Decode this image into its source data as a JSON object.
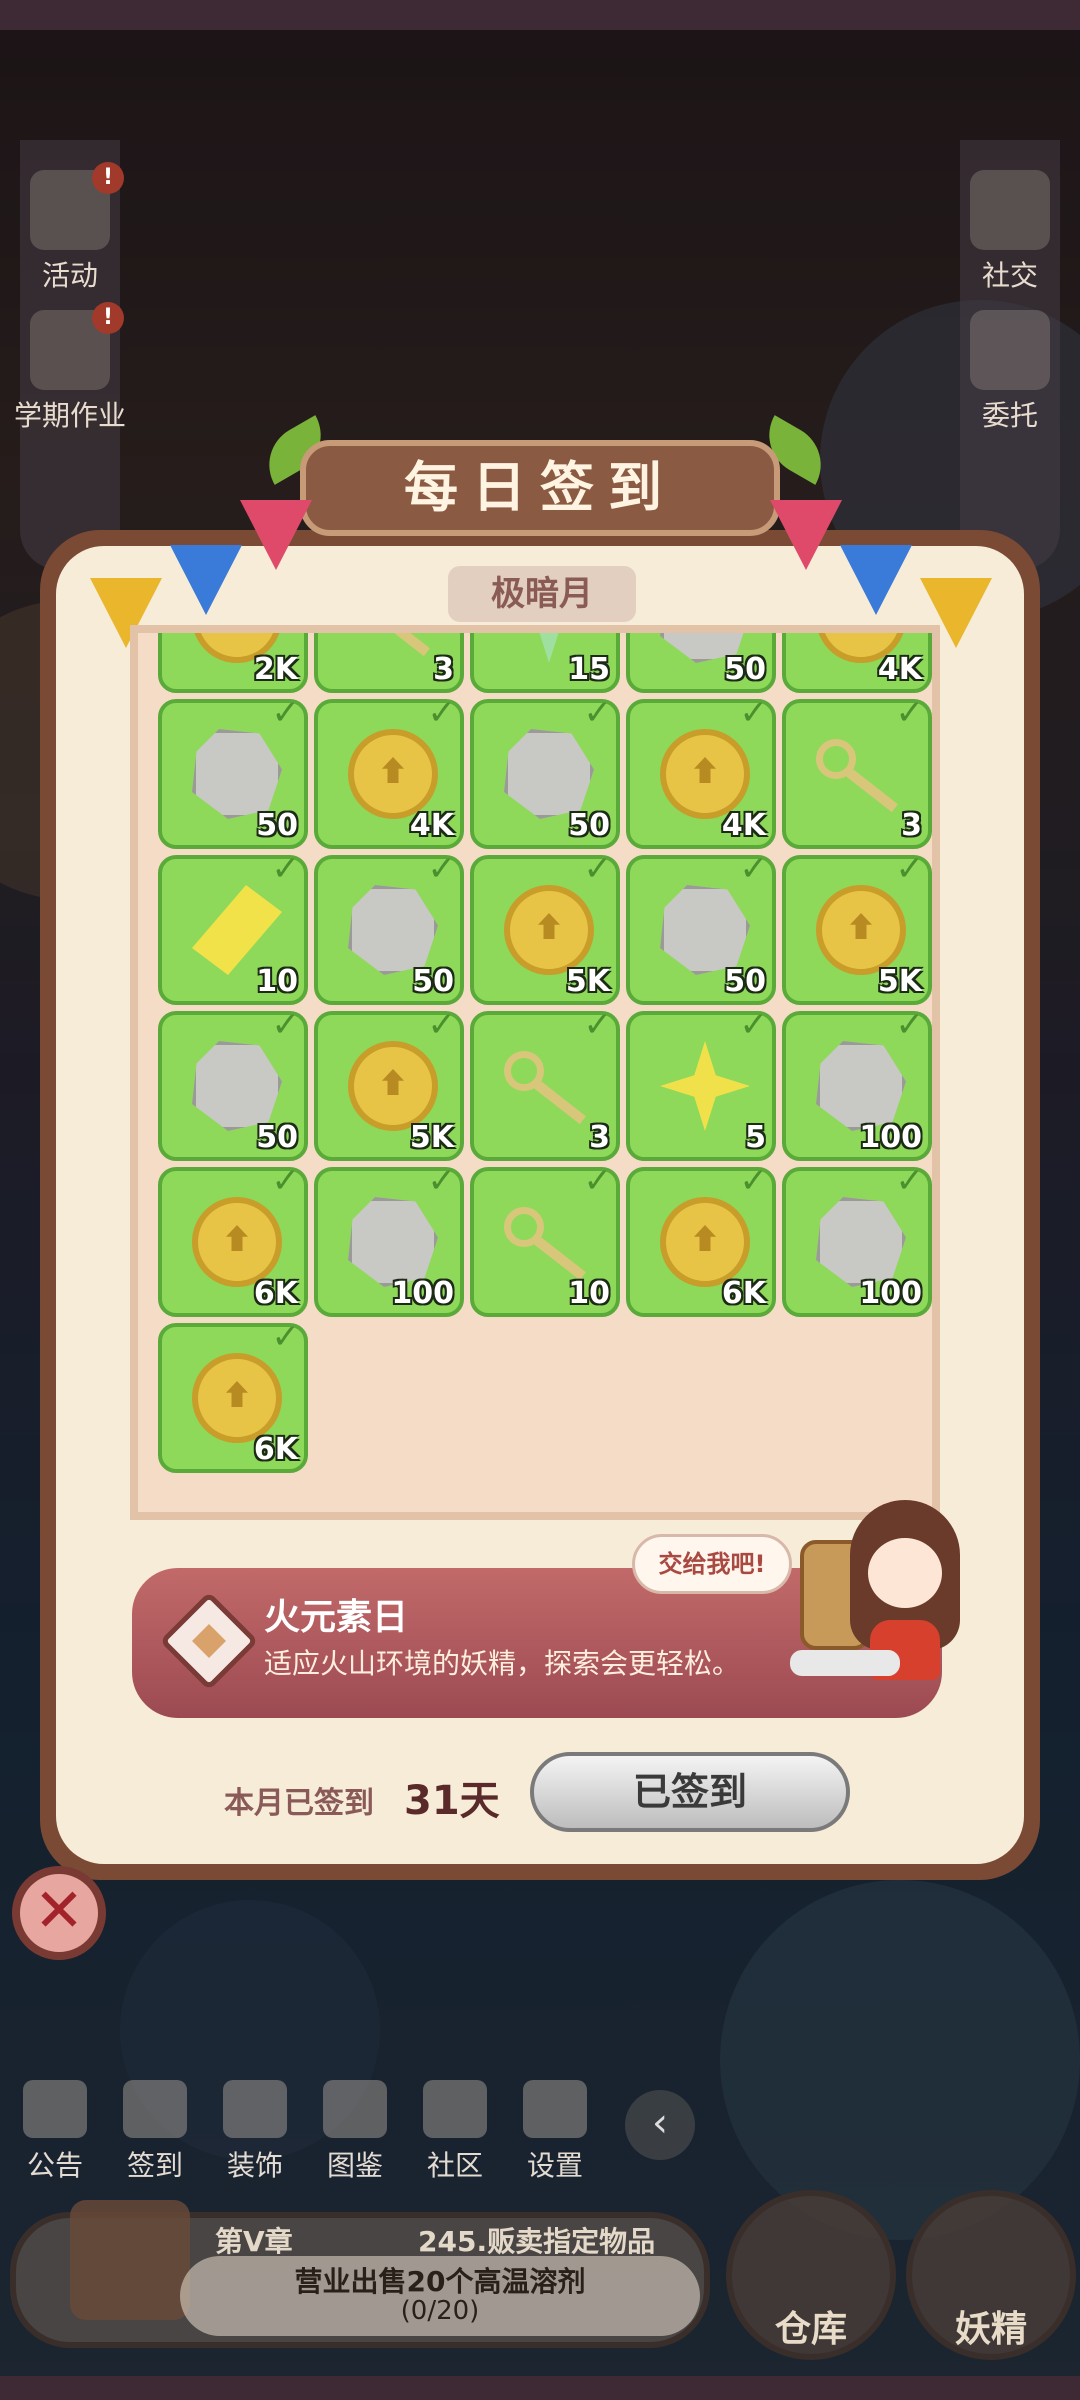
{
  "side_left": [
    {
      "label": "活动",
      "alert": "!"
    },
    {
      "label": "学期作业",
      "alert": "!"
    }
  ],
  "side_right": [
    {
      "label": "社交"
    },
    {
      "label": "委托"
    }
  ],
  "dialog": {
    "title": "每日签到",
    "month": "极暗月",
    "signed_count_label": "本月已签到",
    "signed_count_value": "31天",
    "signed_button": "已签到",
    "close_icon": "✕"
  },
  "rewards": [
    {
      "item": "coin-icon",
      "qty": "2K"
    },
    {
      "item": "key-icon",
      "qty": "3"
    },
    {
      "item": "green-star-icon",
      "qty": "15"
    },
    {
      "item": "gem-icon",
      "qty": "50"
    },
    {
      "item": "coin-icon",
      "qty": "4K"
    },
    {
      "item": "gem-icon",
      "qty": "50"
    },
    {
      "item": "coin-icon",
      "qty": "4K"
    },
    {
      "item": "gem-icon",
      "qty": "50"
    },
    {
      "item": "coin-icon",
      "qty": "4K"
    },
    {
      "item": "key-icon",
      "qty": "3"
    },
    {
      "item": "yellow-diamond-icon",
      "qty": "10"
    },
    {
      "item": "gem-icon",
      "qty": "50"
    },
    {
      "item": "coin-icon",
      "qty": "5K"
    },
    {
      "item": "gem-icon",
      "qty": "50"
    },
    {
      "item": "coin-icon",
      "qty": "5K"
    },
    {
      "item": "gem-icon",
      "qty": "50"
    },
    {
      "item": "coin-icon",
      "qty": "5K"
    },
    {
      "item": "key-icon",
      "qty": "3"
    },
    {
      "item": "yellow-star-icon",
      "qty": "5"
    },
    {
      "item": "gem-icon",
      "qty": "100"
    },
    {
      "item": "coin-icon",
      "qty": "6K"
    },
    {
      "item": "gem-icon",
      "qty": "100"
    },
    {
      "item": "key-icon",
      "qty": "10"
    },
    {
      "item": "coin-icon",
      "qty": "6K"
    },
    {
      "item": "gem-icon",
      "qty": "100"
    },
    {
      "item": "coin-icon",
      "qty": "6K"
    }
  ],
  "check_mark": "✓",
  "info": {
    "title": "火元素日",
    "description": "适应火山环境的妖精，探索会更轻松。",
    "speech": "交给我吧!"
  },
  "toolbar": [
    {
      "label": "公告",
      "icon": "notice-icon"
    },
    {
      "label": "签到",
      "icon": "checkin-icon"
    },
    {
      "label": "装饰",
      "icon": "decor-icon"
    },
    {
      "label": "图鉴",
      "icon": "book-icon"
    },
    {
      "label": "社区",
      "icon": "home-icon"
    },
    {
      "label": "设置",
      "icon": "gear-icon"
    }
  ],
  "toolbar_arrow": "‹",
  "quest": {
    "chapter": "第V章",
    "title": "245.贩卖指定物品",
    "description": "营业出售20个高温溶剂",
    "progress": "(0/20)"
  },
  "corner_buttons": {
    "warehouse": "仓库",
    "fairy": "妖精"
  },
  "colors": {
    "cell_green": "#8ed85a",
    "panel_cream": "#f6ecd8",
    "frame_brown": "#7a4a34",
    "info_red": "#9c4a52"
  }
}
